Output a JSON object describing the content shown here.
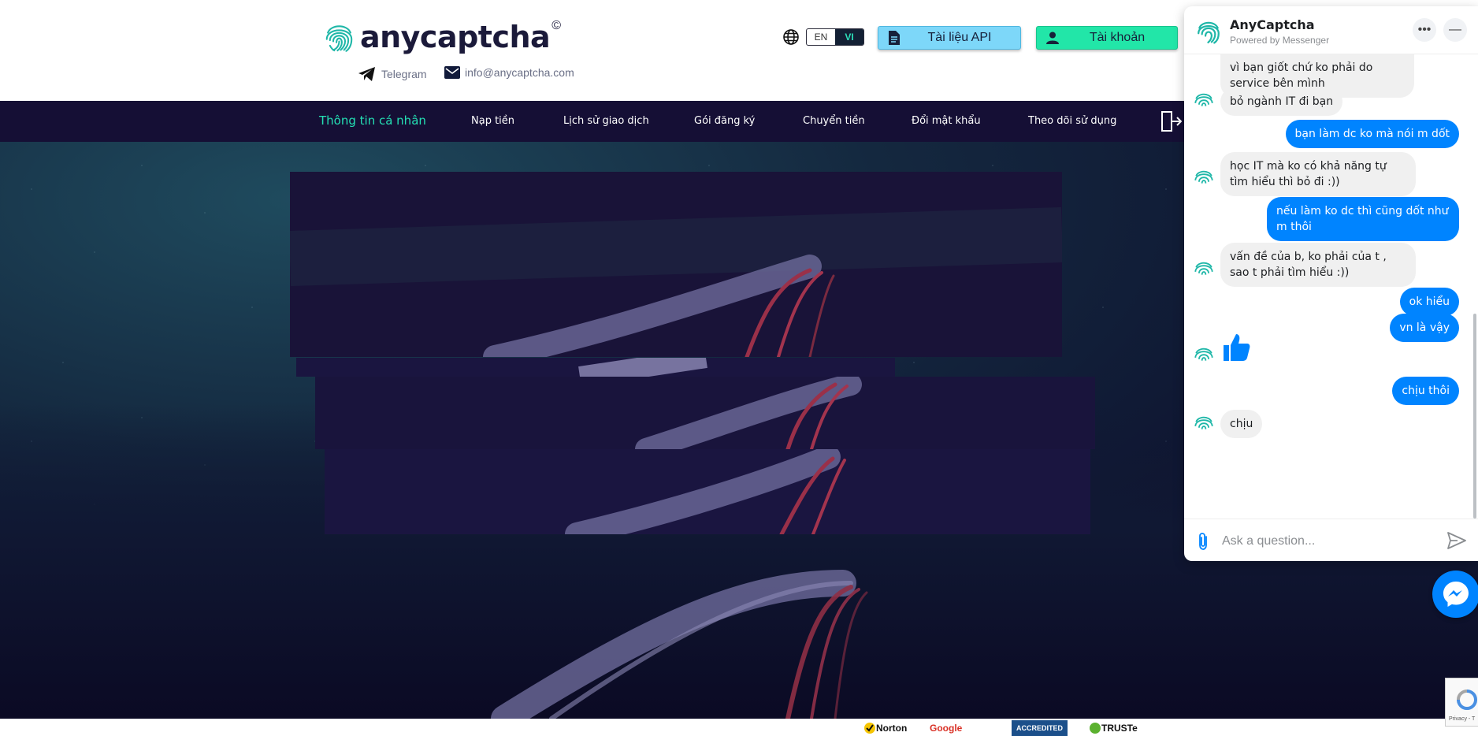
{
  "header": {
    "brand": "anycaptcha",
    "brand_mark": "©",
    "telegram": "Telegram",
    "email": "info@anycaptcha.com",
    "lang_en": "EN",
    "lang_vi": "VI",
    "api_docs": "Tài liệu API",
    "account": "Tài khoản"
  },
  "nav": {
    "items": [
      {
        "label": "Thông tin cá nhân"
      },
      {
        "label": "Nạp tiền"
      },
      {
        "label": "Lịch sử giao dịch"
      },
      {
        "label": "Gói đăng ký"
      },
      {
        "label": "Chuyển tiền"
      },
      {
        "label": "Đổi mật khẩu"
      },
      {
        "label": "Theo dõi sử dụng"
      }
    ]
  },
  "chat": {
    "title": "AnyCaptcha",
    "subtitle": "Powered by Messenger",
    "messages": [
      {
        "from": "in",
        "text": "vì bạn giốt chứ ko phải do service bên mình"
      },
      {
        "from": "in",
        "text": "bỏ ngành IT đi bạn"
      },
      {
        "from": "out",
        "text": "bạn làm dc ko mà nói m dốt"
      },
      {
        "from": "in",
        "text": "học IT mà ko có khả năng tự tìm hiểu thì bỏ đi :))"
      },
      {
        "from": "out",
        "text": "nếu làm ko dc thì cũng dốt như m thôi"
      },
      {
        "from": "in",
        "text": "vấn đề của b, ko phải của t , sao t phải tìm hiểu :))"
      },
      {
        "from": "out",
        "text": "ok hiểu"
      },
      {
        "from": "out",
        "text": "vn là vậy"
      },
      {
        "from": "out",
        "text": "chịu thôi"
      },
      {
        "from": "in",
        "text": "chịu"
      }
    ],
    "input_placeholder": "Ask a question..."
  },
  "footer": {
    "badges": [
      "Norton",
      "Google",
      "ACCREDITED",
      "TRUSTe"
    ]
  },
  "recaptcha": "Privacy - T",
  "colors": {
    "accent": "#24e0b4",
    "nav_bg": "#150f35",
    "api_btn": "#7dd7f9",
    "account_btn": "#22e6a8",
    "messenger_blue": "#0084ff"
  }
}
